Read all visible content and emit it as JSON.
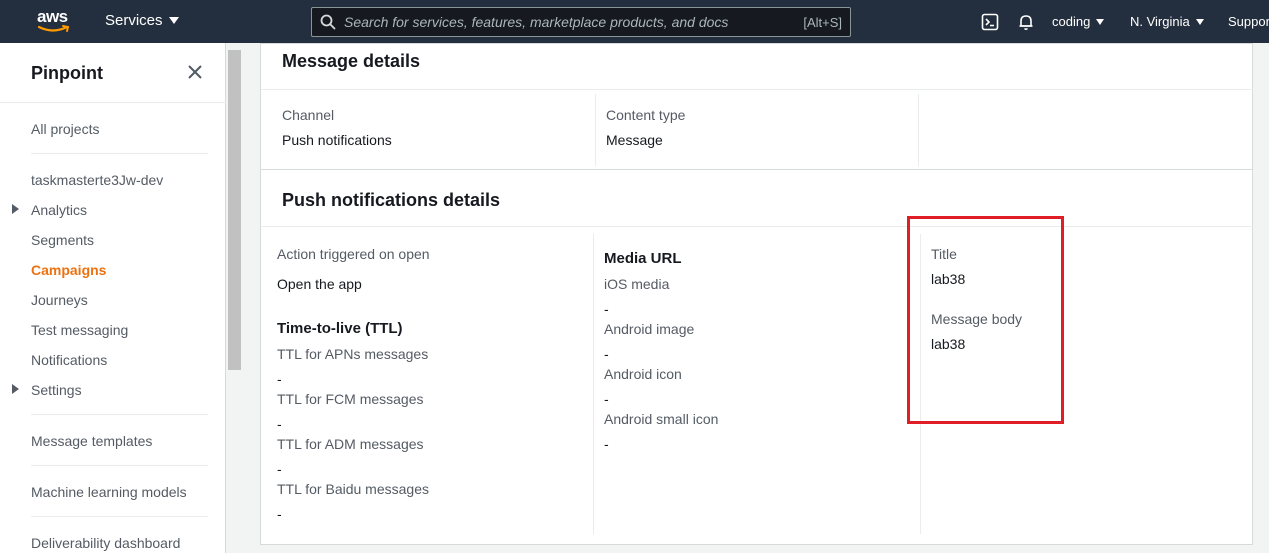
{
  "topnav": {
    "logo": "aws",
    "services_label": "Services",
    "search_placeholder": "Search for services, features, marketplace products, and docs",
    "search_shortcut": "[Alt+S]",
    "account_label": "coding",
    "region_label": "N. Virginia",
    "support_label": "Support",
    "icons": [
      "cloudshell-icon",
      "bell-icon"
    ]
  },
  "sidebar": {
    "title": "Pinpoint",
    "all_projects": "All projects",
    "project_name": "taskmasterte3Jw-dev",
    "items": [
      {
        "label": "Analytics",
        "expandable": true
      },
      {
        "label": "Segments",
        "expandable": false
      },
      {
        "label": "Campaigns",
        "expandable": false,
        "active": true
      },
      {
        "label": "Journeys",
        "expandable": false
      },
      {
        "label": "Test messaging",
        "expandable": false
      },
      {
        "label": "Notifications",
        "expandable": false
      },
      {
        "label": "Settings",
        "expandable": true
      }
    ],
    "message_templates": "Message templates",
    "ml_models": "Machine learning models",
    "deliverability": "Deliverability dashboard"
  },
  "message_details": {
    "heading": "Message details",
    "channel_label": "Channel",
    "channel_value": "Push notifications",
    "content_type_label": "Content type",
    "content_type_value": "Message"
  },
  "push_details": {
    "heading": "Push notifications details",
    "action_label": "Action triggered on open",
    "action_value": "Open the app",
    "ttl_heading": "Time-to-live (TTL)",
    "ttl": [
      {
        "label": "TTL for APNs messages",
        "value": "-"
      },
      {
        "label": "TTL for FCM messages",
        "value": "-"
      },
      {
        "label": "TTL for ADM messages",
        "value": "-"
      },
      {
        "label": "TTL for Baidu messages",
        "value": "-"
      }
    ],
    "media_heading": "Media URL",
    "media": [
      {
        "label": "iOS media",
        "value": "-"
      },
      {
        "label": "Android image",
        "value": "-"
      },
      {
        "label": "Android icon",
        "value": "-"
      },
      {
        "label": "Android small icon",
        "value": "-"
      }
    ],
    "title_label": "Title",
    "title_value": "lab38",
    "body_label": "Message body",
    "body_value": "lab38"
  },
  "colors": {
    "nav_bg": "#232f3e",
    "active_link": "#ec7211",
    "highlight_box": "#e11d25"
  }
}
